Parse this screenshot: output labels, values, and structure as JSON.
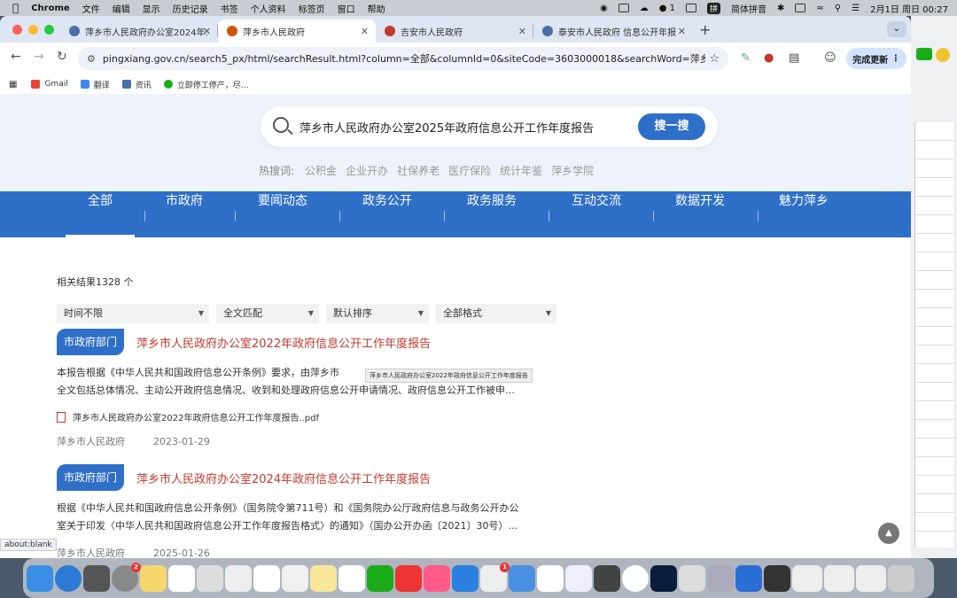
{
  "menubar": {
    "app_name": "Chrome",
    "items": [
      "文件",
      "编辑",
      "显示",
      "历史记录",
      "书签",
      "个人资料",
      "标签页",
      "窗口",
      "帮助"
    ],
    "wechat_count": "1",
    "ime": "拼",
    "ime_label": "简体拼音",
    "clock": "2月1日 周日  00:27"
  },
  "tabs": [
    {
      "title": "萍乡市人民政府办公室2024年…",
      "active": false,
      "color": "#4a6fa5"
    },
    {
      "title": "萍乡市人民政府",
      "active": true,
      "color": "#d35400"
    },
    {
      "title": "吉安市人民政府",
      "active": false,
      "color": "#c0392b"
    },
    {
      "title": "泰安市人民政府 信息公开年报",
      "active": false,
      "color": "#4a6fa5"
    }
  ],
  "toolbar": {
    "url": "pingxiang.gov.cn/search5_px/html/searchResult.html?column=全部&columnId=0&siteCode=3603000018&searchWord=萍乡市人民政…",
    "update_label": "完成更新"
  },
  "bookmarks": [
    {
      "label": "Gmail",
      "color": "#ea4335"
    },
    {
      "label": "翻译",
      "color": "#4285f4"
    },
    {
      "label": "资讯",
      "color": "#4a6fa5"
    },
    {
      "label": "立即停工停产，尽…",
      "color": "#1aad19"
    }
  ],
  "search": {
    "query": "萍乡市人民政府办公室2025年政府信息公开工作年度报告",
    "button": "搜一搜",
    "hot_label": "热搜词:",
    "hot_words": [
      "公积金",
      "企业开办",
      "社保养老",
      "医疗保险",
      "统计年鉴",
      "萍乡学院"
    ]
  },
  "nav": [
    "全部",
    "市政府",
    "要闻动态",
    "政务公开",
    "政务服务",
    "互动交流",
    "数据开发",
    "魅力萍乡"
  ],
  "results_count": "相关结果1328 个",
  "filters": [
    "时间不限",
    "全文匹配",
    "默认排序",
    "全部格式"
  ],
  "results": [
    {
      "badge": "市政府部门",
      "title": "萍乡市人民政府办公室2022年政府信息公开工作年度报告",
      "snippet1": "本报告根据《中华人民共和国政府信息公开条例》要求，由萍乡市",
      "snippet2": "全文包括总体情况、主动公开政府信息情况、收到和处理政府信息公开申请情况、政府信息公开工作被申…",
      "attachment": "萍乡市人民政府办公室2022年政府信息公开工作年度报告..pdf",
      "source": "萍乡市人民政府",
      "date": "2023-01-29"
    },
    {
      "badge": "市政府部门",
      "title": "萍乡市人民政府办公室2024年政府信息公开工作年度报告",
      "snippet1": "根据《中华人民共和国政府信息公开条例》（国务院令第711号）和《国务院办公厅政府信息与政务公开办公",
      "snippet2": "室关于印发〈中华人民共和国政府信息公开工作年度报告格式〉的通知》（国办公开办函〔2021〕30号）…",
      "source": "萍乡市人民政府",
      "date": "2025-01-26"
    }
  ],
  "tooltip": "萍乡市人民政府办公室2022年政府信息公开工作年度报告",
  "status_bar": "about:blank",
  "dock_badges": {
    "settings": "2",
    "app": "1"
  }
}
